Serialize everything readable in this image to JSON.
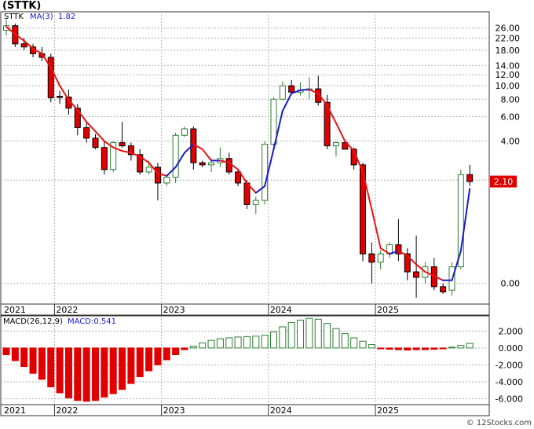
{
  "title": "(STTK)",
  "legend": {
    "symbol": "STTK",
    "ma_label": "MA(3)",
    "ma_value": "1.82"
  },
  "price_badge": "2.10",
  "macd_legend": {
    "label": "MACD(26,12,9)",
    "value_label": "MACD:0.541"
  },
  "watermark": "© 12Stocks.com",
  "colors": {
    "up": "#2e7d32",
    "down": "#e00000",
    "ma_down": "#ee1111",
    "ma_up": "#1a1ad0",
    "badge": "#e00000"
  },
  "chart_data": [
    {
      "type": "candlestick",
      "name": "price",
      "scale": "log",
      "ylim": [
        0.27,
        34
      ],
      "y_ticks": [
        "26.00",
        "22.00",
        "18.00",
        "14.00",
        "12.00",
        "10.00",
        "8.00",
        "6.00",
        "4.00",
        "2.10",
        "0.00"
      ],
      "x_ticks": [
        "2021",
        "2022",
        "2023",
        "2024",
        "2025"
      ],
      "x_tick_month_index": [
        0,
        6,
        18,
        30,
        42
      ],
      "ohlc": [
        [
          25,
          30,
          23,
          27
        ],
        [
          27,
          28,
          19,
          20
        ],
        [
          20,
          22,
          18,
          19
        ],
        [
          19,
          20,
          16,
          17
        ],
        [
          17,
          19,
          15,
          16
        ],
        [
          16,
          17,
          7.6,
          8.2
        ],
        [
          8.4,
          9.2,
          7.4,
          8.3
        ],
        [
          8.3,
          9.4,
          6.2,
          6.9
        ],
        [
          6.9,
          7.4,
          4.4,
          5.0
        ],
        [
          5.0,
          5.4,
          3.9,
          4.2
        ],
        [
          4.2,
          4.5,
          3.5,
          3.6
        ],
        [
          3.6,
          4.0,
          2.3,
          2.5
        ],
        [
          2.5,
          4.0,
          2.4,
          3.9
        ],
        [
          3.9,
          5.5,
          3.6,
          3.7
        ],
        [
          3.7,
          3.9,
          2.9,
          3.2
        ],
        [
          3.2,
          3.5,
          2.3,
          2.4
        ],
        [
          2.4,
          2.9,
          2.3,
          2.6
        ],
        [
          2.6,
          2.8,
          1.5,
          2.0
        ],
        [
          2.0,
          2.3,
          1.9,
          2.2
        ],
        [
          2.2,
          4.6,
          2.0,
          4.4
        ],
        [
          4.4,
          5.1,
          4.3,
          4.9
        ],
        [
          4.9,
          5.1,
          2.5,
          2.8
        ],
        [
          2.8,
          2.9,
          2.6,
          2.7
        ],
        [
          2.7,
          3.0,
          2.4,
          2.8
        ],
        [
          2.8,
          3.6,
          2.6,
          3.0
        ],
        [
          3.0,
          3.3,
          2.3,
          2.4
        ],
        [
          2.4,
          2.5,
          1.9,
          2.0
        ],
        [
          2.0,
          2.1,
          1.3,
          1.4
        ],
        [
          1.4,
          1.6,
          1.2,
          1.5
        ],
        [
          1.5,
          4.0,
          1.4,
          3.8
        ],
        [
          3.8,
          8.3,
          3.7,
          8.0
        ],
        [
          8.0,
          10.8,
          7.9,
          10.0
        ],
        [
          10.0,
          11.0,
          8.9,
          9.0
        ],
        [
          9.0,
          10.6,
          8.5,
          9.3
        ],
        [
          9.3,
          11.5,
          8.0,
          9.5
        ],
        [
          9.5,
          11.8,
          7.2,
          7.6
        ],
        [
          7.6,
          8.6,
          3.5,
          3.7
        ],
        [
          3.7,
          4.0,
          3.1,
          3.9
        ],
        [
          3.9,
          4.0,
          3.5,
          3.5
        ],
        [
          3.5,
          3.6,
          2.5,
          2.7
        ],
        [
          2.7,
          2.8,
          0.55,
          0.62
        ],
        [
          0.62,
          0.75,
          0.38,
          0.54
        ],
        [
          0.54,
          0.66,
          0.48,
          0.62
        ],
        [
          0.62,
          0.75,
          0.58,
          0.72
        ],
        [
          0.72,
          1.1,
          0.55,
          0.62
        ],
        [
          0.62,
          0.68,
          0.4,
          0.46
        ],
        [
          0.46,
          0.84,
          0.3,
          0.42
        ],
        [
          0.42,
          0.54,
          0.38,
          0.5
        ],
        [
          0.5,
          0.58,
          0.34,
          0.36
        ],
        [
          0.36,
          0.38,
          0.32,
          0.33
        ],
        [
          0.34,
          0.54,
          0.31,
          0.5
        ],
        [
          0.5,
          2.5,
          0.48,
          2.3
        ],
        [
          2.3,
          2.7,
          1.9,
          2.05
        ]
      ],
      "ma": [
        26.5,
        23.5,
        21.0,
        18.5,
        17.0,
        13.5,
        10.0,
        7.9,
        6.7,
        5.5,
        4.7,
        4.0,
        3.6,
        3.4,
        3.3,
        3.1,
        2.8,
        2.35,
        2.25,
        2.6,
        3.3,
        3.8,
        3.5,
        2.9,
        2.9,
        2.8,
        2.5,
        2.0,
        1.7,
        1.9,
        3.5,
        6.6,
        8.8,
        9.3,
        9.4,
        8.8,
        7.2,
        5.4,
        4.0,
        3.4,
        2.4,
        1.3,
        0.68,
        0.62,
        0.65,
        0.6,
        0.52,
        0.46,
        0.43,
        0.4,
        0.4,
        0.65,
        1.82
      ]
    },
    {
      "type": "bar",
      "name": "MACD",
      "ylim": [
        -6.7,
        3.8
      ],
      "y_ticks": [
        "2.000",
        "0.000",
        "-2.000",
        "-4.000",
        "-6.000"
      ],
      "x_ticks": [
        "2021",
        "2022",
        "2023",
        "2024",
        "2025"
      ],
      "values": [
        -0.8,
        -1.5,
        -2.2,
        -3.0,
        -3.7,
        -4.6,
        -5.3,
        -5.9,
        -6.2,
        -6.3,
        -6.2,
        -5.8,
        -5.4,
        -4.9,
        -4.2,
        -3.4,
        -2.7,
        -2.0,
        -1.4,
        -0.8,
        -0.2,
        0.2,
        0.6,
        0.9,
        1.1,
        1.2,
        1.3,
        1.35,
        1.4,
        1.5,
        1.9,
        2.5,
        3.0,
        3.3,
        3.5,
        3.4,
        2.9,
        2.3,
        1.7,
        1.2,
        0.8,
        0.4,
        -0.1,
        -0.15,
        -0.2,
        -0.25,
        -0.2,
        -0.2,
        -0.15,
        -0.1,
        0.1,
        0.3,
        0.541
      ]
    }
  ]
}
